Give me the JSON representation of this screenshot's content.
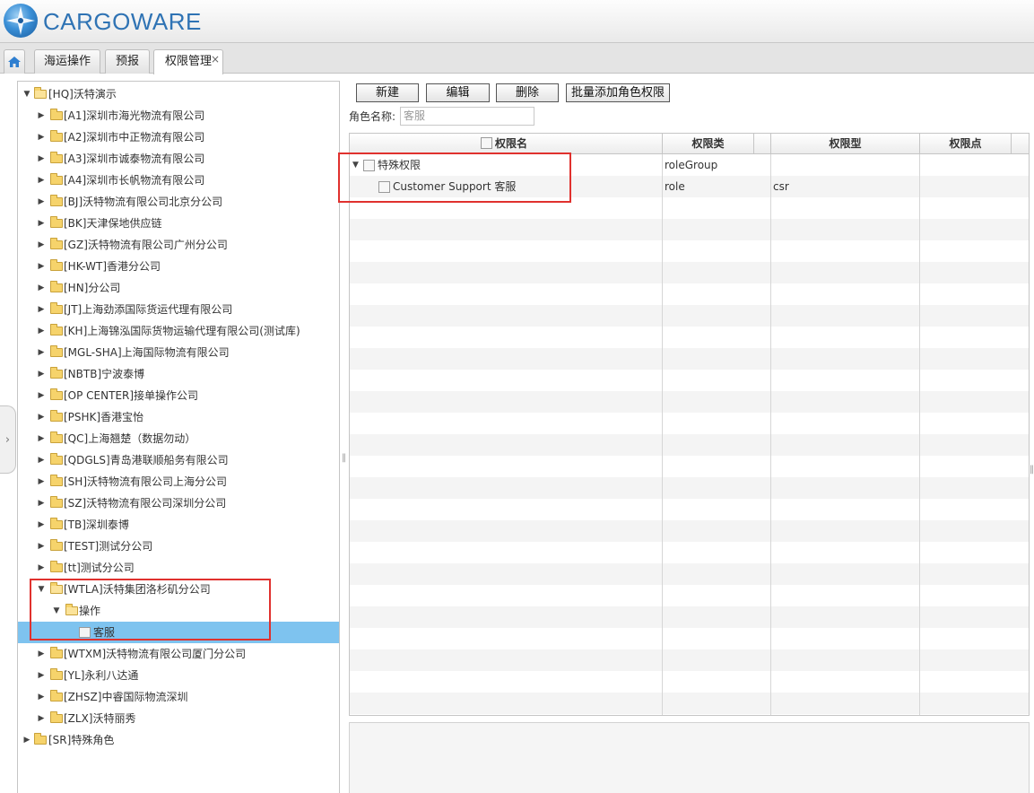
{
  "app": {
    "brand": "CARGOWARE"
  },
  "tabs": [
    {
      "label": "海运操作"
    },
    {
      "label": "预报"
    },
    {
      "label": "权限管理",
      "close": "×"
    }
  ],
  "tree": {
    "root": "[HQ]沃特演示",
    "items": [
      "[A1]深圳市海光物流有限公司",
      "[A2]深圳市中正物流有限公司",
      "[A3]深圳市诚泰物流有限公司",
      "[A4]深圳市长帆物流有限公司",
      "[BJ]沃特物流有限公司北京分公司",
      "[BK]天津保地供应链",
      "[GZ]沃特物流有限公司广州分公司",
      "[HK-WT]香港分公司",
      "[HN]分公司",
      "[JT]上海劲添国际货运代理有限公司",
      "[KH]上海锦泓国际货物运输代理有限公司(测试库)",
      "[MGL-SHA]上海国际物流有限公司",
      "[NBTB]宁波泰博",
      "[OP CENTER]接单操作公司",
      "[PSHK]香港宝怡",
      "[QC]上海翘楚（数据勿动）",
      "[QDGLS]青岛港联顺船务有限公司",
      "[SH]沃特物流有限公司上海分公司",
      "[SZ]沃特物流有限公司深圳分公司",
      "[TB]深圳泰博",
      "[TEST]测试分公司",
      "[tt]测试分公司"
    ],
    "expanded_company": "[WTLA]沃特集团洛杉矶分公司",
    "expanded_group": "操作",
    "selected_role": "客服",
    "items_after": [
      "[WTXM]沃特物流有限公司厦门分公司",
      "[YL]永利八达通",
      "[ZHSZ]中睿国际物流深圳",
      "[ZLX]沃特丽秀"
    ],
    "root2": "[SR]特殊角色"
  },
  "toolbar": {
    "new_label": "新建",
    "edit_label": "编辑",
    "delete_label": "删除",
    "batch_label": "批量添加角色权限"
  },
  "role_form": {
    "label": "角色名称:",
    "value": "客服"
  },
  "grid": {
    "columns": [
      "权限名",
      "权限类",
      "权限型",
      "权限点"
    ],
    "rows": [
      {
        "name": "特殊权限",
        "type": "roleGroup",
        "kind": "",
        "point": ""
      },
      {
        "name": "Customer Support 客服",
        "type": "role",
        "kind": "csr",
        "point": ""
      }
    ]
  },
  "colors": {
    "selected_row": "#7ec3ef",
    "highlight": "#e0312e",
    "brand": "#2f73b4"
  }
}
